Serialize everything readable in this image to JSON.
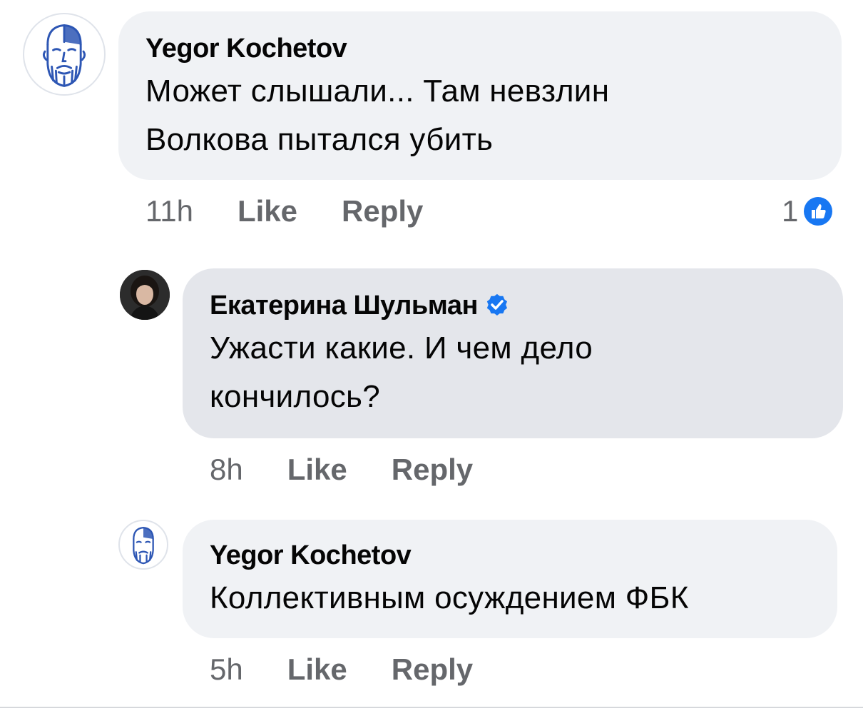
{
  "comments": [
    {
      "author": "Yegor Kochetov",
      "text_line1": "Может слышали... Там невзлин",
      "text_line2": "Волкова пытался убить",
      "time": "11h",
      "like": "Like",
      "reply": "Reply",
      "reaction_count": "1"
    },
    {
      "author": "Екатерина Шульман",
      "text_line1": "Ужасти какие. И чем дело",
      "text_line2": "кончилось?",
      "time": "8h",
      "like": "Like",
      "reply": "Reply",
      "verified": true
    },
    {
      "author": "Yegor Kochetov",
      "text_line1": "Коллективным осуждением ФБК",
      "time": "5h",
      "like": "Like",
      "reply": "Reply"
    }
  ],
  "colors": {
    "bubble": "#f0f2f5",
    "bubble_selected": "#e4e6eb",
    "secondary_text": "#65676b",
    "accent": "#1877f2",
    "avatar_line": "#2d56b4"
  },
  "icons": {
    "avatar_1": "bearded-man-drawing-avatar",
    "avatar_2": "woman-photo-avatar",
    "reaction": "thumbs-up-icon",
    "verified": "verified-badge-icon"
  }
}
